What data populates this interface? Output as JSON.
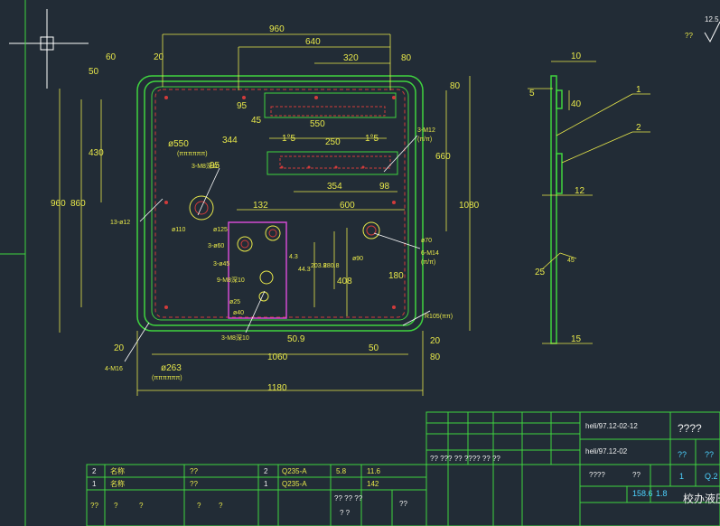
{
  "colors": {
    "background": "#222c36",
    "outline": "#3fd43f",
    "dimension": "#e8e84a",
    "hidden": "#d23b3b",
    "highlight": "#d24bd2",
    "titleblock_text": "#f0f0f0",
    "accent": "#4dd2ff"
  },
  "dimensions": {
    "d960_top": "960",
    "d640": "640",
    "d320": "320",
    "d80_top": "80",
    "d20_top": "20",
    "d60": "60",
    "d50": "50",
    "d80_right": "80",
    "d95_a": "95",
    "d45": "45",
    "d344": "344",
    "d95_b": "95",
    "d550": "550",
    "d1x5_a": "1°5",
    "d1x5_b": "1°5",
    "d250": "250",
    "d354": "354",
    "d98": "98",
    "d660": "660",
    "d1080": "1080",
    "d430": "430",
    "d860": "860",
    "d960_left": "960",
    "dia550": "ø550",
    "dia550_note": "(ππππππ)",
    "m8_a": "3-M8深10",
    "m12": "3-M12",
    "m12_note": "(π/π)",
    "holes12": "13-ø12",
    "dia110": "ø110",
    "dia125": "ø125",
    "d132": "132",
    "d600": "600",
    "d4_3": "4.3",
    "d44_3": "44.3",
    "d203_8": "203.8",
    "d280_8": "280.8",
    "d408": "408",
    "d3_dia60": "3-ø60",
    "d3_dia45": "3-ø45",
    "m8_b": "9-M8深10",
    "d25": "ø25",
    "d40": "ø40",
    "m8_c": "3-M8深10",
    "d50_9": "50.9",
    "d70": "ø70",
    "dia90": "ø90",
    "m14": "6-M14",
    "m14_note": "(π/π)",
    "d180": "180",
    "r105": "R105(ππ)",
    "d20_bot": "20",
    "d50_bot": "50",
    "d80_bot": "80",
    "d1060": "1060",
    "d1180": "1180",
    "dia263": "ø263",
    "dia263_note": "(ππππππ)",
    "m16": "4-M16",
    "d20_left": "20"
  },
  "side_view": {
    "d10": "10",
    "d5": "5",
    "d40": "40",
    "d12": "12",
    "d15": "15",
    "d25": "25",
    "callout_1": "1",
    "callout_2": "2",
    "weld_mark": "45"
  },
  "surface_finish": {
    "value": "12.5",
    "note": "??"
  },
  "title_block": {
    "drawing_no_1": "heli/97.12-02-12",
    "drawing_no_2": "heli/97.12-02",
    "name": "????",
    "header_qm": "??",
    "row_a": "?? ??? ?? ???? ?? ??",
    "row_b": "????",
    "scale_label": "??",
    "scale_qm": "??",
    "qty": "1",
    "material_short": "Q.2",
    "weight_1": "158.6",
    "weight_2": "1.8",
    "company": "校办液压中",
    "r1_no": "2",
    "r1_code": "名称",
    "r1_qm": "??",
    "r1_qty": "2",
    "r1_mat": "Q235-A",
    "r1_w1": "5.8",
    "r1_w2": "11.6",
    "r2_no": "1",
    "r2_code": "名称",
    "r2_qm": "??",
    "r2_qty": "1",
    "r2_mat": "Q235-A",
    "r2_w2": "142",
    "r3_a": "??",
    "r3_b": "?",
    "r3_c": "?",
    "r3_d": "?",
    "r3_e": "?",
    "r3_f": "?? ?? ??",
    "r3_g": "??",
    "r3_h": "?  ?"
  }
}
